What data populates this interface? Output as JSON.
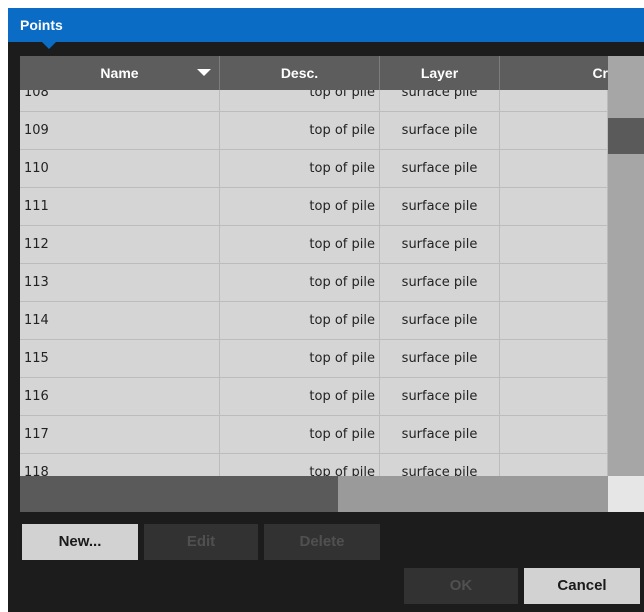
{
  "window": {
    "title": "Points"
  },
  "table": {
    "columns": [
      "Name",
      "Desc.",
      "Layer",
      "Cr"
    ],
    "partial_row": {
      "name": "108",
      "desc": "top of pile",
      "layer": "surface pile"
    },
    "rows": [
      {
        "name": "109",
        "desc": "top of pile",
        "layer": "surface pile",
        "cr": ""
      },
      {
        "name": "110",
        "desc": "top of pile",
        "layer": "surface pile",
        "cr": ""
      },
      {
        "name": "111",
        "desc": "top of pile",
        "layer": "surface pile",
        "cr": ""
      },
      {
        "name": "112",
        "desc": "top of pile",
        "layer": "surface pile",
        "cr": ""
      },
      {
        "name": "113",
        "desc": "top of pile",
        "layer": "surface pile",
        "cr": ""
      },
      {
        "name": "114",
        "desc": "top of pile",
        "layer": "surface pile",
        "cr": ""
      },
      {
        "name": "115",
        "desc": "top of pile",
        "layer": "surface pile",
        "cr": ""
      },
      {
        "name": "116",
        "desc": "top of pile",
        "layer": "surface pile",
        "cr": ""
      },
      {
        "name": "117",
        "desc": "top of pile",
        "layer": "surface pile",
        "cr": ""
      },
      {
        "name": "118",
        "desc": "top of pile",
        "layer": "surface pile",
        "cr": ""
      }
    ]
  },
  "buttons": {
    "new": "New...",
    "edit": "Edit",
    "delete": "Delete",
    "ok": "OK",
    "cancel": "Cancel"
  },
  "colors": {
    "accent": "#0a6cc4",
    "background": "#1c1c1c",
    "header": "#5d5d5d",
    "row": "#d5d5d5"
  }
}
